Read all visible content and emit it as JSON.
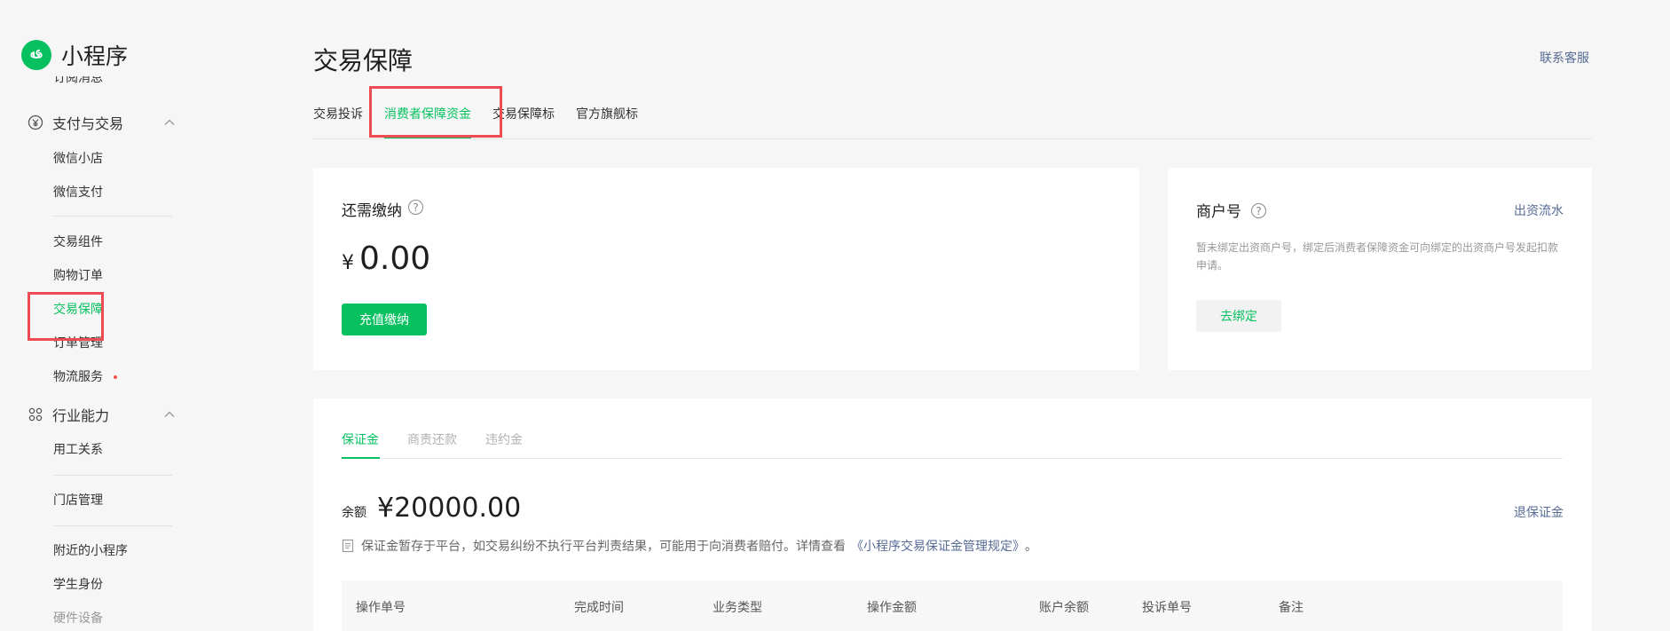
{
  "sidebar": {
    "logo_text": "小程序",
    "top_cut_item": "订阅消息",
    "groups": [
      {
        "label": "支付与交易",
        "icon": "yuan-circle-icon"
      },
      {
        "label": "行业能力",
        "icon": "industry-icon"
      }
    ],
    "items": [
      {
        "label": "微信小店"
      },
      {
        "label": "微信支付"
      },
      {
        "label": "交易组件"
      },
      {
        "label": "购物订单"
      },
      {
        "label": "交易保障"
      },
      {
        "label": "订单管理"
      },
      {
        "label": "物流服务"
      },
      {
        "label": "用工关系"
      },
      {
        "label": "门店管理"
      },
      {
        "label": "附近的小程序"
      },
      {
        "label": "学生身份"
      },
      {
        "label": "硬件设备"
      }
    ]
  },
  "header": {
    "title": "交易保障",
    "contact_link": "联系客服"
  },
  "tabs": [
    {
      "label": "交易投诉"
    },
    {
      "label": "消费者保障资金"
    },
    {
      "label": "交易保障标"
    },
    {
      "label": "官方旗舰标"
    }
  ],
  "payment_card": {
    "label": "还需缴纳",
    "currency": "¥",
    "amount": "0.00",
    "button": "充值缴纳"
  },
  "merchant_card": {
    "label": "商户号",
    "flow_link": "出资流水",
    "desc": "暂未绑定出资商户号，绑定后消费者保障资金可向绑定的出资商户号发起扣款申请。",
    "button": "去绑定"
  },
  "deposit": {
    "subtabs": [
      {
        "label": "保证金"
      },
      {
        "label": "商责还款"
      },
      {
        "label": "违约金"
      }
    ],
    "balance_label": "余额",
    "balance_value": "¥20000.00",
    "refund_link": "退保证金",
    "notice": "保证金暂存于平台，如交易纠纷不执行平台判责结果，可能用于向消费者赔付。详情查看",
    "notice_link": "《小程序交易保证金管理规定》",
    "notice_end": "。"
  },
  "table": {
    "columns": [
      "操作单号",
      "完成时间",
      "业务类型",
      "操作金额",
      "账户余额",
      "投诉单号",
      "备注"
    ]
  },
  "colors": {
    "accent": "#07c160",
    "link": "#576b95",
    "annotation": "#ee4c52"
  }
}
